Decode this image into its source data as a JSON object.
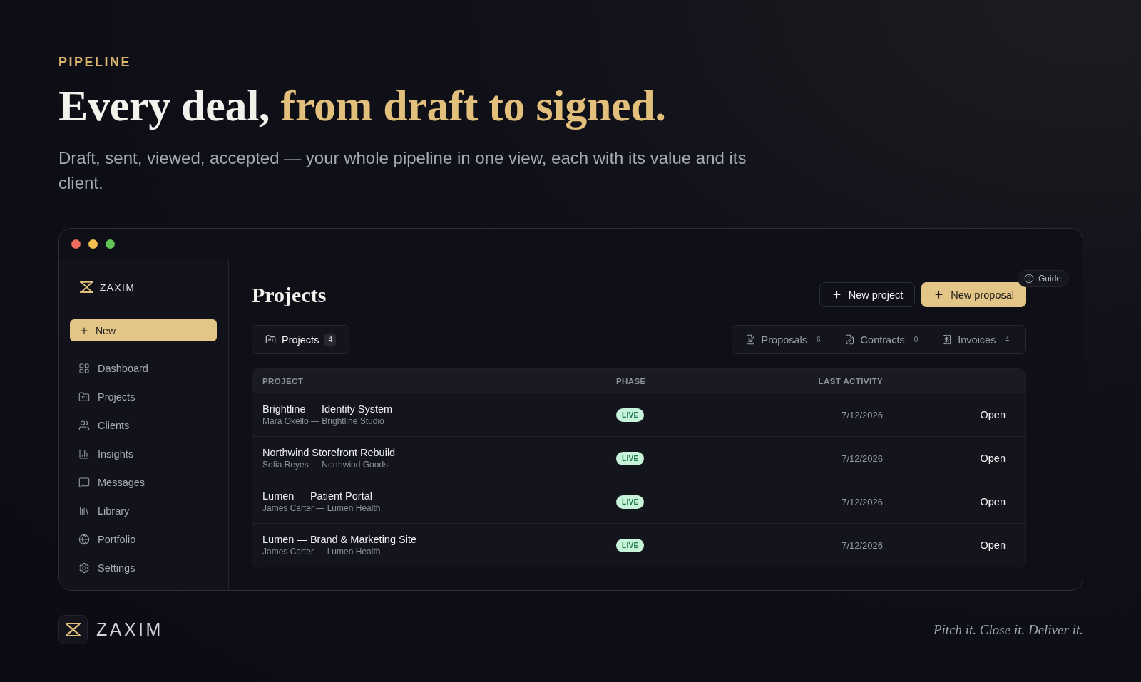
{
  "hero": {
    "eyebrow": "PIPELINE",
    "headline": {
      "lead": "Every deal,",
      "accent": "from draft to signed."
    },
    "subtitle": "Draft, sent, viewed, accepted — your whole pipeline in one view, each with its value and its client."
  },
  "sidebar": {
    "brand": "ZAXIM",
    "new_button": "New",
    "items": [
      {
        "label": "Dashboard",
        "selected": false
      },
      {
        "label": "Projects",
        "selected": false
      },
      {
        "label": "Clients",
        "selected": false
      },
      {
        "label": "Insights",
        "selected": false
      },
      {
        "label": "Messages",
        "selected": false
      },
      {
        "label": "Library",
        "selected": false
      },
      {
        "label": "Portfolio",
        "selected": false
      },
      {
        "label": "Settings",
        "selected": false
      }
    ]
  },
  "main": {
    "title": "Projects",
    "guide": "Guide",
    "actions": [
      {
        "label": "New project",
        "kind": "secondary"
      },
      {
        "label": "New proposal",
        "kind": "primary"
      }
    ],
    "tab_groups": [
      {
        "tabs": [
          {
            "label": "Projects",
            "count": "4",
            "selected": true
          }
        ]
      },
      {
        "tabs": [
          {
            "label": "Proposals",
            "count": "6",
            "selected": false
          },
          {
            "label": "Contracts",
            "count": "0",
            "selected": false
          },
          {
            "label": "Invoices",
            "count": "4",
            "selected": false
          }
        ]
      }
    ],
    "table": {
      "columns": [
        "PROJECT",
        "PHASE",
        "LAST ACTIVITY"
      ],
      "rows": [
        {
          "project": "Brightline — Identity System",
          "client": "Mara Okello — Brightline Studio",
          "phase": "LIVE",
          "last_activity": "7/12/2026",
          "action": "Open"
        },
        {
          "project": "Northwind Storefront Rebuild",
          "client": "Sofia Reyes — Northwind Goods",
          "phase": "LIVE",
          "last_activity": "7/12/2026",
          "action": "Open"
        },
        {
          "project": "Lumen — Patient Portal",
          "client": "James Carter — Lumen Health",
          "phase": "LIVE",
          "last_activity": "7/12/2026",
          "action": "Open"
        },
        {
          "project": "Lumen — Brand & Marketing Site",
          "client": "James Carter — Lumen Health",
          "phase": "LIVE",
          "last_activity": "7/12/2026",
          "action": "Open"
        }
      ]
    }
  },
  "footer": {
    "brand": "ZAXIM",
    "tagline": "Pitch it. Close it. Deliver it."
  }
}
